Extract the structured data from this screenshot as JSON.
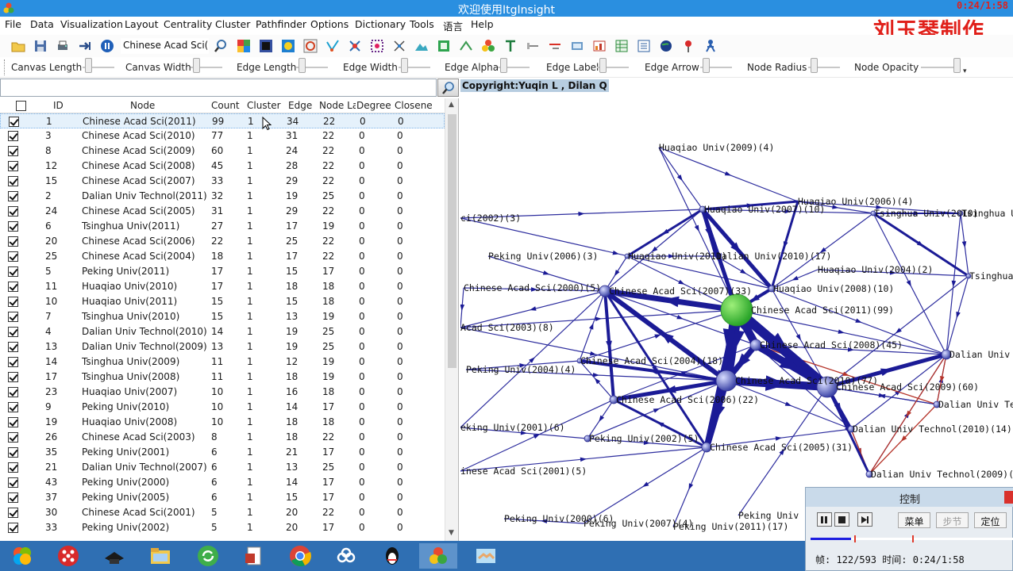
{
  "window": {
    "title": "欢迎使用ItgInsight",
    "clock": "0:24/1:58"
  },
  "menu": [
    "File",
    "Data",
    "Visualization",
    "Layout",
    "Centrality",
    "Cluster",
    "Pathfinder",
    "Options",
    "Dictionary",
    "Tools",
    "语言",
    "Help"
  ],
  "watermark": "刘玉琴制作",
  "toolbar": {
    "combo_value": "Chinese Acad Sci(2011)",
    "icons": [
      "open-icon",
      "save-icon",
      "print-icon",
      "export-icon",
      "pause-icon",
      "zoom-icon",
      "color-icon",
      "black-node-icon",
      "circle-node-icon",
      "ring-icon",
      "layout-icon",
      "network-icon",
      "grid-icon",
      "cross-icon",
      "mountain-icon",
      "square-icon",
      "tree-icon",
      "cluster-icon",
      "text-icon",
      "edge-icon",
      "red-edge-icon",
      "image-icon",
      "chart-icon",
      "table-icon",
      "list-icon",
      "globe-icon",
      "pin-icon",
      "person-icon"
    ]
  },
  "sliders": [
    "Canvas Length",
    "Canvas Width",
    "Edge Length",
    "Edge Width",
    "Edge Alpha",
    "Edge Label",
    "Edge Arrow",
    "Node Radius",
    "Node Opacity"
  ],
  "search": {
    "value": "",
    "placeholder": ""
  },
  "table": {
    "columns": [
      "ID",
      "Node",
      "Count",
      "Cluster",
      "Edge",
      "Node La",
      "Degree",
      "Closene"
    ],
    "rows": [
      [
        "1",
        "Chinese Acad Sci(2011)",
        "99",
        "1",
        "34",
        "22",
        "0",
        "0"
      ],
      [
        "3",
        "Chinese Acad Sci(2010)",
        "77",
        "1",
        "31",
        "22",
        "0",
        "0"
      ],
      [
        "8",
        "Chinese Acad Sci(2009)",
        "60",
        "1",
        "24",
        "22",
        "0",
        "0"
      ],
      [
        "12",
        "Chinese Acad Sci(2008)",
        "45",
        "1",
        "28",
        "22",
        "0",
        "0"
      ],
      [
        "15",
        "Chinese Acad Sci(2007)",
        "33",
        "1",
        "29",
        "22",
        "0",
        "0"
      ],
      [
        "2",
        "Dalian Univ Technol(2011)",
        "32",
        "1",
        "19",
        "25",
        "0",
        "0"
      ],
      [
        "24",
        "Chinese Acad Sci(2005)",
        "31",
        "1",
        "29",
        "22",
        "0",
        "0"
      ],
      [
        "6",
        "Tsinghua Univ(2011)",
        "27",
        "1",
        "17",
        "19",
        "0",
        "0"
      ],
      [
        "20",
        "Chinese Acad Sci(2006)",
        "22",
        "1",
        "25",
        "22",
        "0",
        "0"
      ],
      [
        "25",
        "Chinese Acad Sci(2004)",
        "18",
        "1",
        "17",
        "22",
        "0",
        "0"
      ],
      [
        "5",
        "Peking Univ(2011)",
        "17",
        "1",
        "15",
        "17",
        "0",
        "0"
      ],
      [
        "11",
        "Huaqiao Univ(2010)",
        "17",
        "1",
        "18",
        "18",
        "0",
        "0"
      ],
      [
        "10",
        "Huaqiao Univ(2011)",
        "15",
        "1",
        "15",
        "18",
        "0",
        "0"
      ],
      [
        "7",
        "Tsinghua Univ(2010)",
        "15",
        "1",
        "13",
        "19",
        "0",
        "0"
      ],
      [
        "4",
        "Dalian Univ Technol(2010)",
        "14",
        "1",
        "19",
        "25",
        "0",
        "0"
      ],
      [
        "13",
        "Dalian Univ Technol(2009)",
        "13",
        "1",
        "19",
        "25",
        "0",
        "0"
      ],
      [
        "14",
        "Tsinghua Univ(2009)",
        "11",
        "1",
        "12",
        "19",
        "0",
        "0"
      ],
      [
        "17",
        "Tsinghua Univ(2008)",
        "11",
        "1",
        "18",
        "19",
        "0",
        "0"
      ],
      [
        "23",
        "Huaqiao Univ(2007)",
        "10",
        "1",
        "16",
        "18",
        "0",
        "0"
      ],
      [
        "9",
        "Peking Univ(2010)",
        "10",
        "1",
        "14",
        "17",
        "0",
        "0"
      ],
      [
        "19",
        "Huaqiao Univ(2008)",
        "10",
        "1",
        "18",
        "18",
        "0",
        "0"
      ],
      [
        "26",
        "Chinese Acad Sci(2003)",
        "8",
        "1",
        "18",
        "22",
        "0",
        "0"
      ],
      [
        "35",
        "Peking Univ(2001)",
        "6",
        "1",
        "21",
        "17",
        "0",
        "0"
      ],
      [
        "21",
        "Dalian Univ Technol(2007)",
        "6",
        "1",
        "13",
        "25",
        "0",
        "0"
      ],
      [
        "43",
        "Peking Univ(2000)",
        "6",
        "1",
        "14",
        "17",
        "0",
        "0"
      ],
      [
        "37",
        "Peking Univ(2005)",
        "6",
        "1",
        "15",
        "17",
        "0",
        "0"
      ],
      [
        "30",
        "Chinese Acad Sci(2001)",
        "5",
        "1",
        "20",
        "22",
        "0",
        "0"
      ],
      [
        "33",
        "Peking Univ(2002)",
        "5",
        "1",
        "20",
        "17",
        "0",
        "0"
      ]
    ]
  },
  "canvas": {
    "copyright": "Copyright:Yuqin L , Dilan Q",
    "labels": [
      "Huaqiao Univ(2009)(4)",
      "Huaqiao Univ(2006)(4)",
      "Huaqiao Univ(2007)(10)",
      "Tsinghua Univ(2010)",
      "Tsinghua Univ",
      "ci(2002)(3)",
      "Peking Univ(2006)(3)",
      "Huaqiao Univ(2011)",
      "Dalian Univ(2010)(17)",
      "Huaqiao Univ(2004)(2)",
      "Tsinghua",
      "Chinese Acad Sci(2000)(5)",
      "Chinese Acad Sci(2007)(33)",
      "Huaqiao Univ(2008)(10)",
      "Chinese Acad Sci(2011)(99)",
      "Acad Sci(2003)(8)",
      "Chinese Acad Sci(2008)(45)",
      "Dalian Univ T",
      "Peking Univ(2004)(4)",
      "Chinese Acad Sci(2004)(18)",
      "Chinese Acad Sci(2010)(77)",
      "Chinese Acad Sci(2009)(60)",
      "Chinese Acad Sci(2006)(22)",
      "Dalian Univ Te",
      "eking Univ(2001)(6)",
      "Peking Univ(2002)(5)",
      "Chinese Acad Sci(2005)(31)",
      "Dalian Univ Technol(2010)(14)",
      "inese Acad Sci(2001)(5)",
      "Dalian Univ Technol(2009)(13",
      "Peking Univ(2000)(6)",
      "Peking Univ(2007)(4)",
      "Peking Univ(2011)(17)",
      "Peking Univ"
    ]
  },
  "control": {
    "title": "控制",
    "buttons": [
      "菜单",
      "步节",
      "定位"
    ],
    "progress": 0.2,
    "info": "帧: 122/593 时间: 0:24/1:58"
  },
  "taskbar": [
    "windows-icon",
    "app-grid-icon",
    "hat-icon",
    "folder-icon",
    "refresh-icon",
    "document-icon",
    "chrome-icon",
    "cloud-icon",
    "qq-penguin-icon",
    "itginsight-icon",
    "handshake-icon"
  ]
}
